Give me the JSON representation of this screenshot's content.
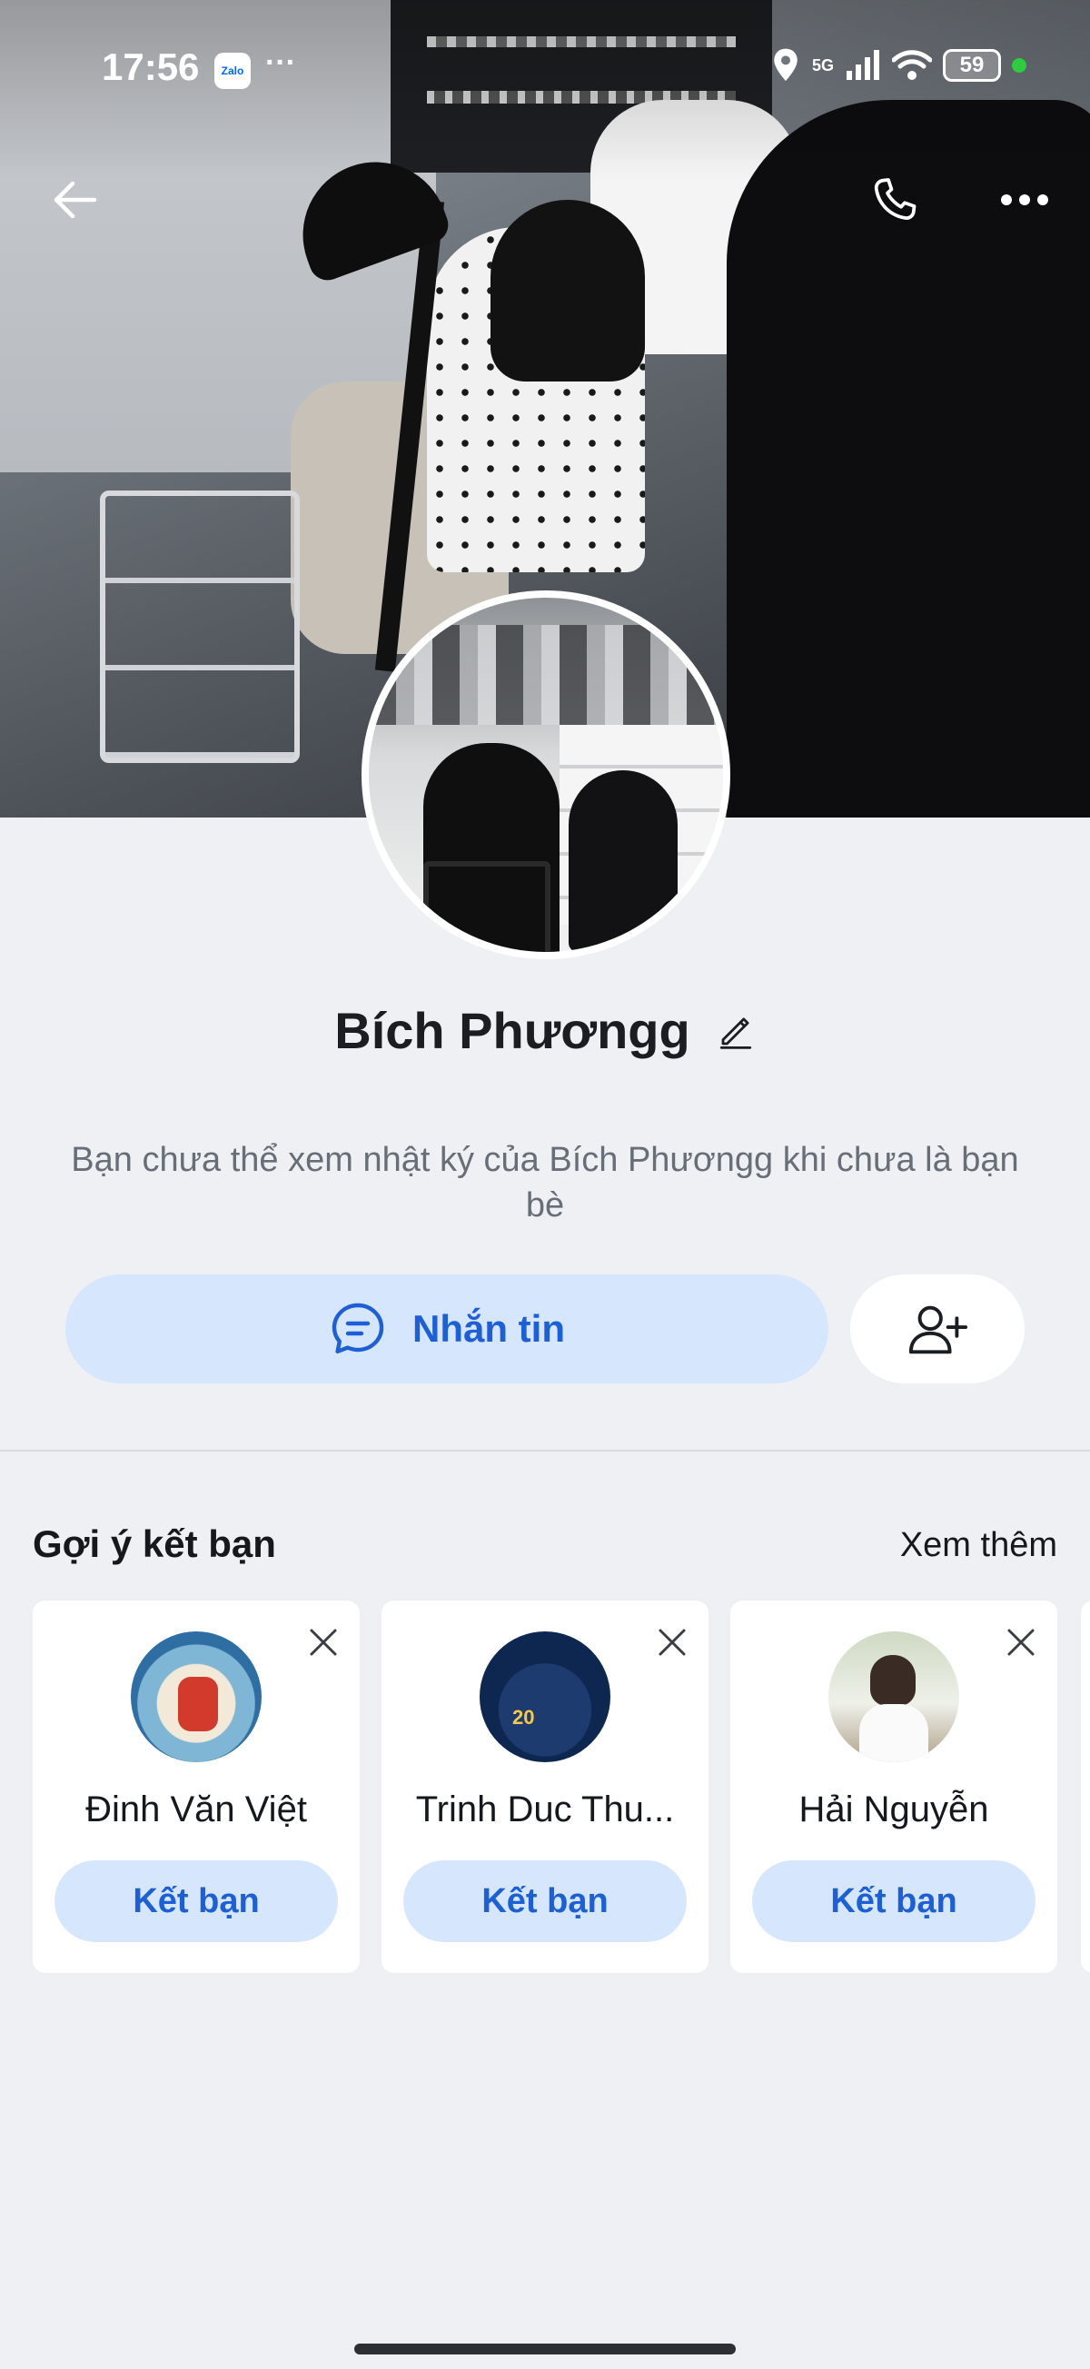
{
  "status_bar": {
    "time": "17:56",
    "app_badge": "Zalo",
    "overflow": "···",
    "network": "5G",
    "battery": "59"
  },
  "profile": {
    "name": "Bích Phươngg",
    "diary_notice": "Bạn chưa thể xem nhật ký của Bích Phươngg khi chưa là bạn bè"
  },
  "actions": {
    "message_label": "Nhắn tin"
  },
  "suggestions": {
    "title": "Gợi ý kết bạn",
    "see_more": "Xem thêm",
    "items": [
      {
        "name": "Đinh Văn Việt",
        "button": "Kết bạn"
      },
      {
        "name": "Trinh Duc Thu...",
        "button": "Kết bạn"
      },
      {
        "name": "Hải Nguyễn",
        "button": "Kết bạn"
      }
    ]
  },
  "colors": {
    "accent": "#1c5fd6",
    "accent_bg": "#d6e6fd",
    "page_bg": "#eef0f4"
  },
  "icons": {
    "back": "arrow-left-icon",
    "call": "phone-icon",
    "more": "more-horizontal-icon",
    "edit": "pencil-icon",
    "message": "chat-bubble-icon",
    "add_friend": "user-plus-icon",
    "close": "close-icon"
  }
}
